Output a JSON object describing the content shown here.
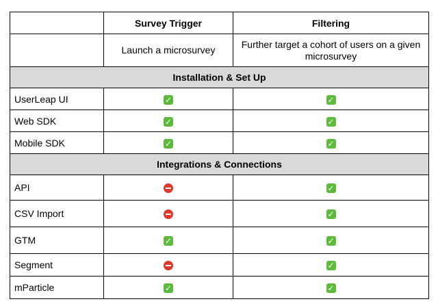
{
  "columns": {
    "trigger": {
      "title": "Survey Trigger",
      "description": "Launch a microsurvey"
    },
    "filtering": {
      "title": "Filtering",
      "description": "Further target a cohort of users on a given microsurvey"
    }
  },
  "sections": [
    {
      "title": "Installation & Set Up",
      "rows": [
        {
          "label": "UserLeap UI",
          "trigger": "check",
          "filtering": "check"
        },
        {
          "label": "Web SDK",
          "trigger": "check",
          "filtering": "check"
        },
        {
          "label": "Mobile SDK",
          "trigger": "check",
          "filtering": "check"
        }
      ]
    },
    {
      "title": "Integrations & Connections",
      "rows": [
        {
          "label": "API",
          "trigger": "no-entry",
          "filtering": "check"
        },
        {
          "label": "CSV Import",
          "trigger": "no-entry",
          "filtering": "check"
        },
        {
          "label": "GTM",
          "trigger": "check",
          "filtering": "check"
        },
        {
          "label": "Segment",
          "trigger": "no-entry",
          "filtering": "check"
        },
        {
          "label": "mParticle",
          "trigger": "check",
          "filtering": "check"
        }
      ]
    }
  ],
  "icons": {
    "check": {
      "name": "check-mark-icon",
      "glyph": "✓",
      "color": "#5cbb3a"
    },
    "no-entry": {
      "name": "no-entry-icon",
      "color": "#e0392b"
    }
  },
  "colors": {
    "section_background": "#d9d9d9",
    "border": "#000000"
  }
}
